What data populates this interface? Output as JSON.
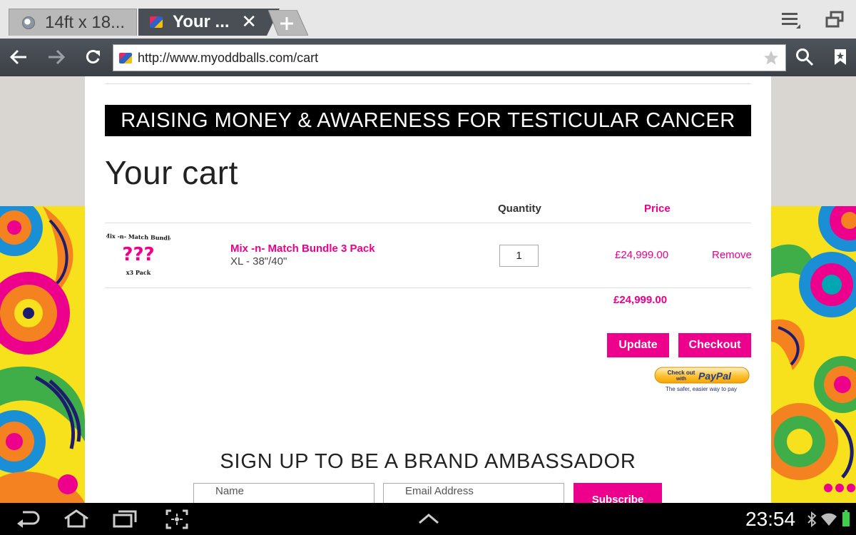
{
  "browser": {
    "tabs": [
      {
        "title": "14ft x 18...",
        "favicon": "globe-icon",
        "active": false
      },
      {
        "title": "Your ...",
        "favicon": "site-favicon",
        "active": true
      }
    ],
    "url": "http://www.myoddballs.com/cart"
  },
  "page": {
    "banner": "RAISING MONEY & AWARENESS FOR TESTICULAR CANCER",
    "title": "Your cart",
    "columns": {
      "quantity": "Quantity",
      "price": "Price"
    },
    "item": {
      "thumb_title": "Mix -n- Match Bundle",
      "thumb_marks": "???",
      "thumb_pack": "x3 Pack",
      "name": "Mix -n- Match Bundle 3 Pack",
      "variant": "XL - 38\"/40\"",
      "quantity": "1",
      "price": "£24,999.00",
      "remove": "Remove"
    },
    "total": "£24,999.00",
    "update_label": "Update",
    "checkout_label": "Checkout",
    "paypal": {
      "line1": "Check out",
      "line2": "with",
      "brand": "PayPal",
      "tagline": "The safer, easier way to pay"
    },
    "signup_title": "SIGN UP TO BE A BRAND AMBASSADOR",
    "name_placeholder": "Name",
    "email_placeholder": "Email Address",
    "subscribe_label": "Subscribe"
  },
  "system": {
    "time": "23:54"
  },
  "colors": {
    "accent": "#ec008c",
    "toolbar": "#4a4f56",
    "banner": "#000000"
  }
}
